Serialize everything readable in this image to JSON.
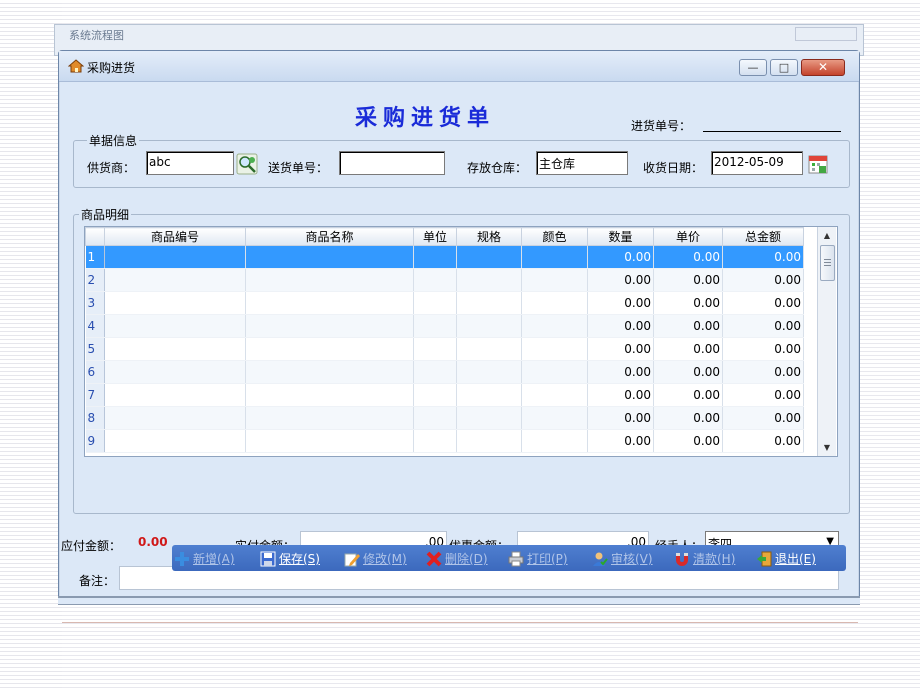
{
  "background_window": {
    "title": "系统流程图"
  },
  "window": {
    "title": "采购进货",
    "controls": {
      "minimize": "—",
      "maximize": "□",
      "close": "✕"
    }
  },
  "form": {
    "heading": "采购进货单",
    "doc_no_label": "进货单号："
  },
  "bill_info": {
    "legend": "单据信息",
    "supplier_label": "供货商：",
    "supplier_value": "abc",
    "delivery_no_label": "送货单号：",
    "delivery_no_value": "",
    "warehouse_label": "存放仓库：",
    "warehouse_value": "主仓库",
    "receive_date_label": "收货日期：",
    "receive_date_value": "2012-05-09"
  },
  "items": {
    "legend": "商品明细",
    "columns": [
      "",
      "商品编号",
      "商品名称",
      "单位",
      "规格",
      "颜色",
      "数量",
      "单价",
      "总金额"
    ],
    "rows": [
      {
        "n": "1",
        "qty": "0.00",
        "price": "0.00",
        "total": "0.00"
      },
      {
        "n": "2",
        "qty": "0.00",
        "price": "0.00",
        "total": "0.00"
      },
      {
        "n": "3",
        "qty": "0.00",
        "price": "0.00",
        "total": "0.00"
      },
      {
        "n": "4",
        "qty": "0.00",
        "price": "0.00",
        "total": "0.00"
      },
      {
        "n": "5",
        "qty": "0.00",
        "price": "0.00",
        "total": "0.00"
      },
      {
        "n": "6",
        "qty": "0.00",
        "price": "0.00",
        "total": "0.00"
      },
      {
        "n": "7",
        "qty": "0.00",
        "price": "0.00",
        "total": "0.00"
      },
      {
        "n": "8",
        "qty": "0.00",
        "price": "0.00",
        "total": "0.00"
      },
      {
        "n": "9",
        "qty": "0.00",
        "price": "0.00",
        "total": "0.00"
      }
    ]
  },
  "summary": {
    "payable_label": "应付金额：",
    "payable_value": "0.00",
    "paid_label": "实付金额：",
    "paid_value": ".00",
    "discount_label": "优惠金额：",
    "discount_value": ".00",
    "handler_label": "经手人：",
    "handler_value": "李四",
    "remark_label": "备注："
  },
  "toolbar": {
    "new": "新增(A)",
    "save": "保存(S)",
    "edit": "修改(M)",
    "delete": "删除(D)",
    "print": "打印(P)",
    "audit": "审核(V)",
    "clear": "清款(H)",
    "exit": "退出(E)"
  },
  "colors": {
    "accent": "#3399ff",
    "heading": "#1a2bd8",
    "amount": "#d01818",
    "toolbar": "#3c69bd"
  }
}
